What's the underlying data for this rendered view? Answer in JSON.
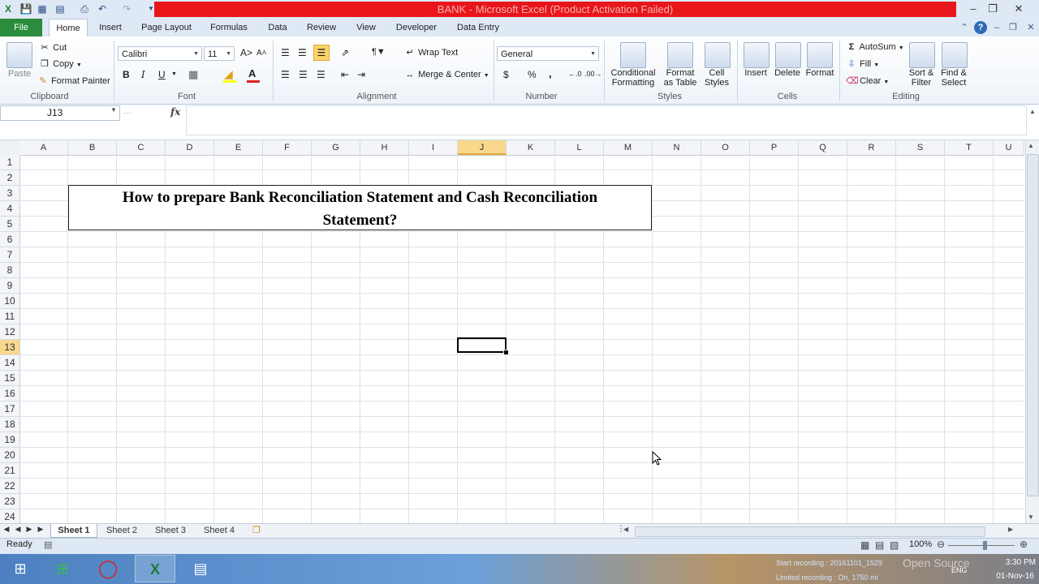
{
  "window": {
    "title": "BANK - Microsoft Excel (Product Activation Failed)",
    "accent": "#e8161b"
  },
  "qat": {
    "icons": [
      "excel-logo-icon",
      "save-icon",
      "open-icon",
      "print-icon",
      "undo-icon",
      "redo-icon",
      "customize-qat-icon"
    ]
  },
  "tabs": {
    "file": "File",
    "items": [
      "Home",
      "Insert",
      "Page Layout",
      "Formulas",
      "Data",
      "Review",
      "View",
      "Developer",
      "Data Entry"
    ],
    "active": "Home"
  },
  "ribbon": {
    "clipboard": {
      "paste": "Paste",
      "cut": "Cut",
      "copy": "Copy",
      "format_painter": "Format Painter",
      "label": "Clipboard"
    },
    "font": {
      "name": "Calibri",
      "size": "11",
      "bold": "B",
      "italic": "I",
      "underline": "U",
      "label": "Font"
    },
    "alignment": {
      "wrap_text": "Wrap Text",
      "merge_center": "Merge & Center",
      "label": "Alignment"
    },
    "number": {
      "format": "General",
      "currency": "$",
      "percent": "%",
      "comma": ",",
      "label": "Number"
    },
    "styles": {
      "conditional_1": "Conditional",
      "conditional_2": "Formatting",
      "format_table_1": "Format",
      "format_table_2": "as Table",
      "cell_styles_1": "Cell",
      "cell_styles_2": "Styles",
      "label": "Styles"
    },
    "cells": {
      "insert": "Insert",
      "delete": "Delete",
      "format": "Format",
      "label": "Cells"
    },
    "editing": {
      "autosum": "AutoSum",
      "fill": "Fill",
      "clear": "Clear",
      "sort_1": "Sort &",
      "sort_2": "Filter",
      "find_1": "Find &",
      "find_2": "Select",
      "label": "Editing"
    }
  },
  "formula_bar": {
    "name_box": "J13",
    "fx": "fx",
    "value": ""
  },
  "grid": {
    "columns": [
      "A",
      "B",
      "C",
      "D",
      "E",
      "F",
      "G",
      "H",
      "I",
      "J",
      "K",
      "L",
      "M",
      "N",
      "O",
      "P",
      "Q",
      "R",
      "S",
      "T",
      "U"
    ],
    "rows": [
      "1",
      "2",
      "3",
      "4",
      "5",
      "6",
      "7",
      "8",
      "9",
      "10",
      "11",
      "12",
      "13",
      "14",
      "15",
      "16",
      "17",
      "18",
      "19",
      "20",
      "21",
      "22",
      "23",
      "24"
    ],
    "selected_column": "J",
    "selected_row": "13",
    "title_line_1": "How to prepare Bank Reconciliation Statement and Cash Reconciliation",
    "title_line_2": "Statement?"
  },
  "sheets": {
    "tabs": [
      "Sheet 1",
      "Sheet 2",
      "Sheet 3",
      "Sheet 4"
    ],
    "active": "Sheet 1"
  },
  "status": {
    "ready": "Ready",
    "zoom": "100%",
    "zoom_fraction": 0.5
  },
  "taskbar": {
    "recording_1": "Start recording : 20161101_1529",
    "recording_2": "Limited recording : On, 1750 mi",
    "watermark": "Open Source",
    "lang": "ENG",
    "time": "3:30 PM",
    "date": "01-Nov-16"
  }
}
